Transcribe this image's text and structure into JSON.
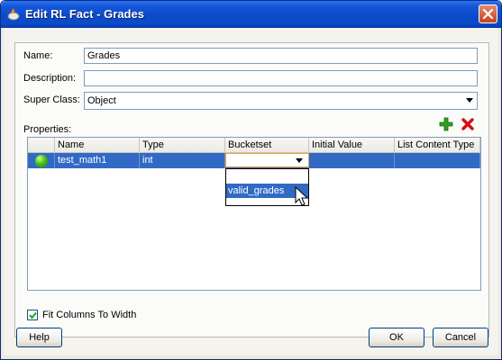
{
  "window": {
    "title": "Edit RL Fact - Grades"
  },
  "form": {
    "name_label": "Name:",
    "name_value": "Grades",
    "description_label": "Description:",
    "description_value": "",
    "superclass_label": "Super Class:",
    "superclass_value": "Object",
    "properties_label": "Properties:"
  },
  "table": {
    "columns": [
      "Name",
      "Type",
      "Bucketset",
      "Initial Value",
      "List Content Type"
    ],
    "rows": [
      {
        "name": "test_math1",
        "type": "int",
        "bucketset": "",
        "initial_value": "",
        "list_content_type": ""
      }
    ],
    "dropdown_options": [
      "",
      "valid_grades"
    ],
    "highlighted_option": "valid_grades"
  },
  "fit_columns": {
    "label": "Fit Columns To Width",
    "checked": true
  },
  "buttons": {
    "help": "Help",
    "ok": "OK",
    "cancel": "Cancel"
  },
  "icons": {
    "add": "plus-icon",
    "delete": "delete-x-icon",
    "row_status": "green-ball-icon",
    "app": "oracle-app-icon"
  },
  "colors": {
    "titlebar": "#0a49c9",
    "selection": "#316ac5",
    "add_icon": "#2fa01c",
    "delete_icon": "#d41010"
  }
}
